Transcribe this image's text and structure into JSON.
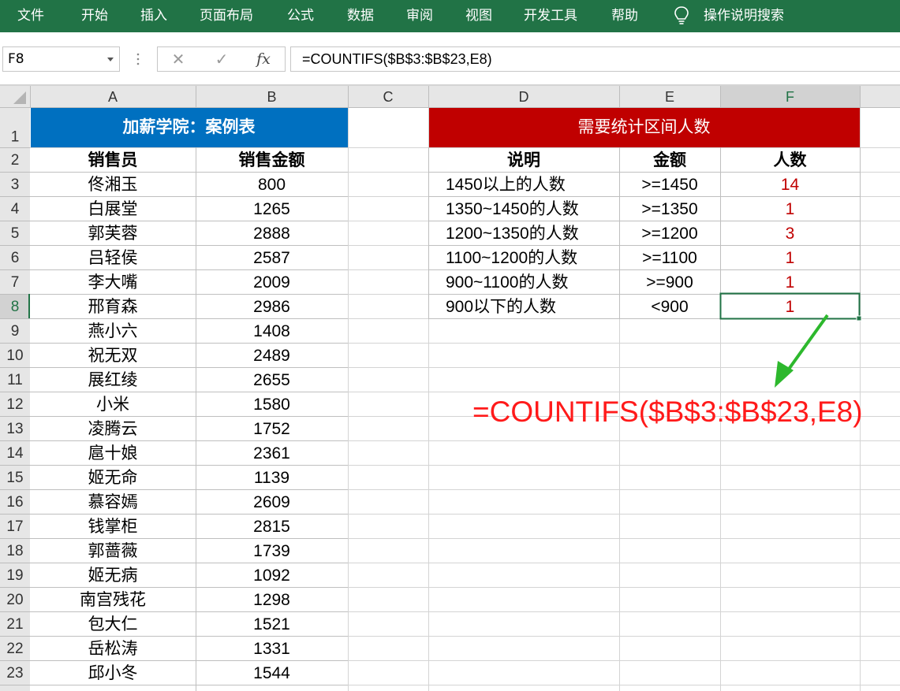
{
  "ribbon": {
    "tabs": [
      "文件",
      "开始",
      "插入",
      "页面布局",
      "公式",
      "数据",
      "审阅",
      "视图",
      "开发工具",
      "帮助"
    ],
    "tell_me": "操作说明搜索",
    "tell_me_icon": "lightbulb-icon",
    "bg_color": "#217346"
  },
  "formula_bar": {
    "name_box": "F8",
    "cancel_icon": "✕",
    "enter_icon": "✓",
    "fx_label": "fx",
    "formula": "=COUNTIFS($B$3:$B$23,E8)"
  },
  "sheet": {
    "columns": [
      "A",
      "B",
      "C",
      "D",
      "E",
      "F"
    ],
    "selected_column": "F",
    "selected_row": "8",
    "active_cell": "F8",
    "rows": [
      "1",
      "2",
      "3",
      "4",
      "5",
      "6",
      "7",
      "8",
      "9",
      "10",
      "11",
      "12",
      "13",
      "14",
      "15",
      "16",
      "17",
      "18",
      "19",
      "20",
      "21",
      "22",
      "23"
    ],
    "left_table": {
      "title": "加薪学院：案例表",
      "title_bg": "#0070C0",
      "headers": [
        "销售员",
        "销售金额"
      ],
      "rows": [
        [
          "佟湘玉",
          "800"
        ],
        [
          "白展堂",
          "1265"
        ],
        [
          "郭芙蓉",
          "2888"
        ],
        [
          "吕轻侯",
          "2587"
        ],
        [
          "李大嘴",
          "2009"
        ],
        [
          "邢育森",
          "2986"
        ],
        [
          "燕小六",
          "1408"
        ],
        [
          "祝无双",
          "2489"
        ],
        [
          "展红绫",
          "2655"
        ],
        [
          "小米",
          "1580"
        ],
        [
          "凌腾云",
          "1752"
        ],
        [
          "扈十娘",
          "2361"
        ],
        [
          "姬无命",
          "1139"
        ],
        [
          "慕容嫣",
          "2609"
        ],
        [
          "钱掌柜",
          "2815"
        ],
        [
          "郭蔷薇",
          "1739"
        ],
        [
          "姬无病",
          "1092"
        ],
        [
          "南宫残花",
          "1298"
        ],
        [
          "包大仁",
          "1521"
        ],
        [
          "岳松涛",
          "1331"
        ],
        [
          "邱小冬",
          "1544"
        ]
      ]
    },
    "right_table": {
      "title": "需要统计区间人数",
      "title_bg": "#C00000",
      "headers": [
        "说明",
        "金额",
        "人数"
      ],
      "rows": [
        [
          "1450以上的人数",
          ">=1450",
          "14"
        ],
        [
          "1350~1450的人数",
          ">=1350",
          "1"
        ],
        [
          "1200~1350的人数",
          ">=1200",
          "3"
        ],
        [
          "1100~1200的人数",
          ">=1100",
          "1"
        ],
        [
          "900~1100的人数",
          ">=900",
          "1"
        ],
        [
          "900以下的人数",
          "<900",
          "1"
        ]
      ],
      "count_color": "#C00000"
    }
  },
  "annotation": {
    "formula": "=COUNTIFS($B$3:$B$23,E8)",
    "color": "#ff1a1a",
    "arrow_color": "#2db82d"
  }
}
